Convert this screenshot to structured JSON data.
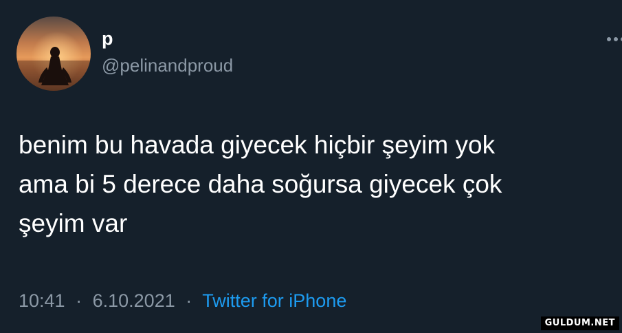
{
  "tweet": {
    "display_name": "p",
    "handle": "@pelinandproud",
    "text": "benim bu havada giyecek hiçbir şeyim yok\nama bi 5 derece daha soğursa giyecek çok\nşeyim var",
    "time": "10:41",
    "date": "6.10.2021",
    "separator": "·",
    "source": "Twitter for iPhone"
  },
  "watermark": "GULDUM.NET",
  "colors": {
    "background": "#15202b",
    "text_primary": "#ffffff",
    "text_secondary": "#8b98a5",
    "link": "#1d9bf0"
  },
  "icons": {
    "more": "more-dots-icon",
    "avatar": "avatar-sunset-silhouette"
  }
}
